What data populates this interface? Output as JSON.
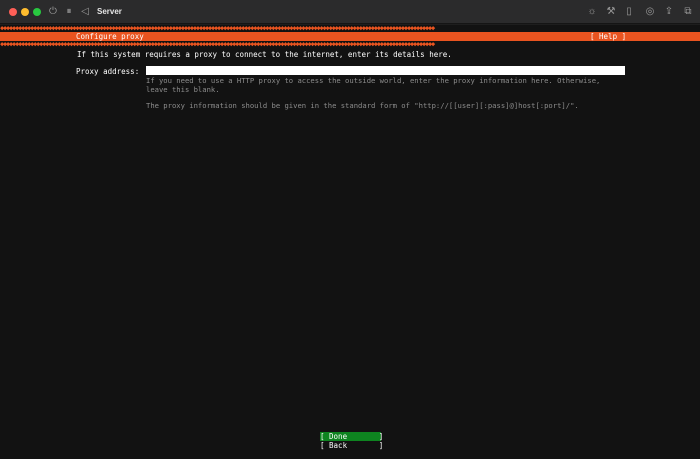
{
  "window": {
    "title": "Server",
    "toolbar_icons": [
      "power-icon",
      "pause-icon",
      "back-icon",
      "brightness-icon",
      "wrench-icon",
      "usb-icon",
      "globe-icon",
      "share-icon",
      "windows-icon"
    ]
  },
  "installer": {
    "header_title": "Configure proxy",
    "help_label": "[ Help ]",
    "intro": "If this system requires a proxy to connect to the internet, enter its details here.",
    "proxy_label": "Proxy address:",
    "proxy_value": "",
    "hint_line1": "If you need to use a HTTP proxy to access the outside world, enter the proxy information here. Otherwise,",
    "hint_line2": "leave this blank.",
    "hint_line3": "The proxy information should be given in the standard form of \"http://[[user][:pass]@]host[:port]/\".",
    "done_label": "[ Done       ]",
    "back_label": "[ Back       ]"
  },
  "colors": {
    "accent": "#E95420",
    "done_button": "#0E8420",
    "background": "#121212"
  }
}
